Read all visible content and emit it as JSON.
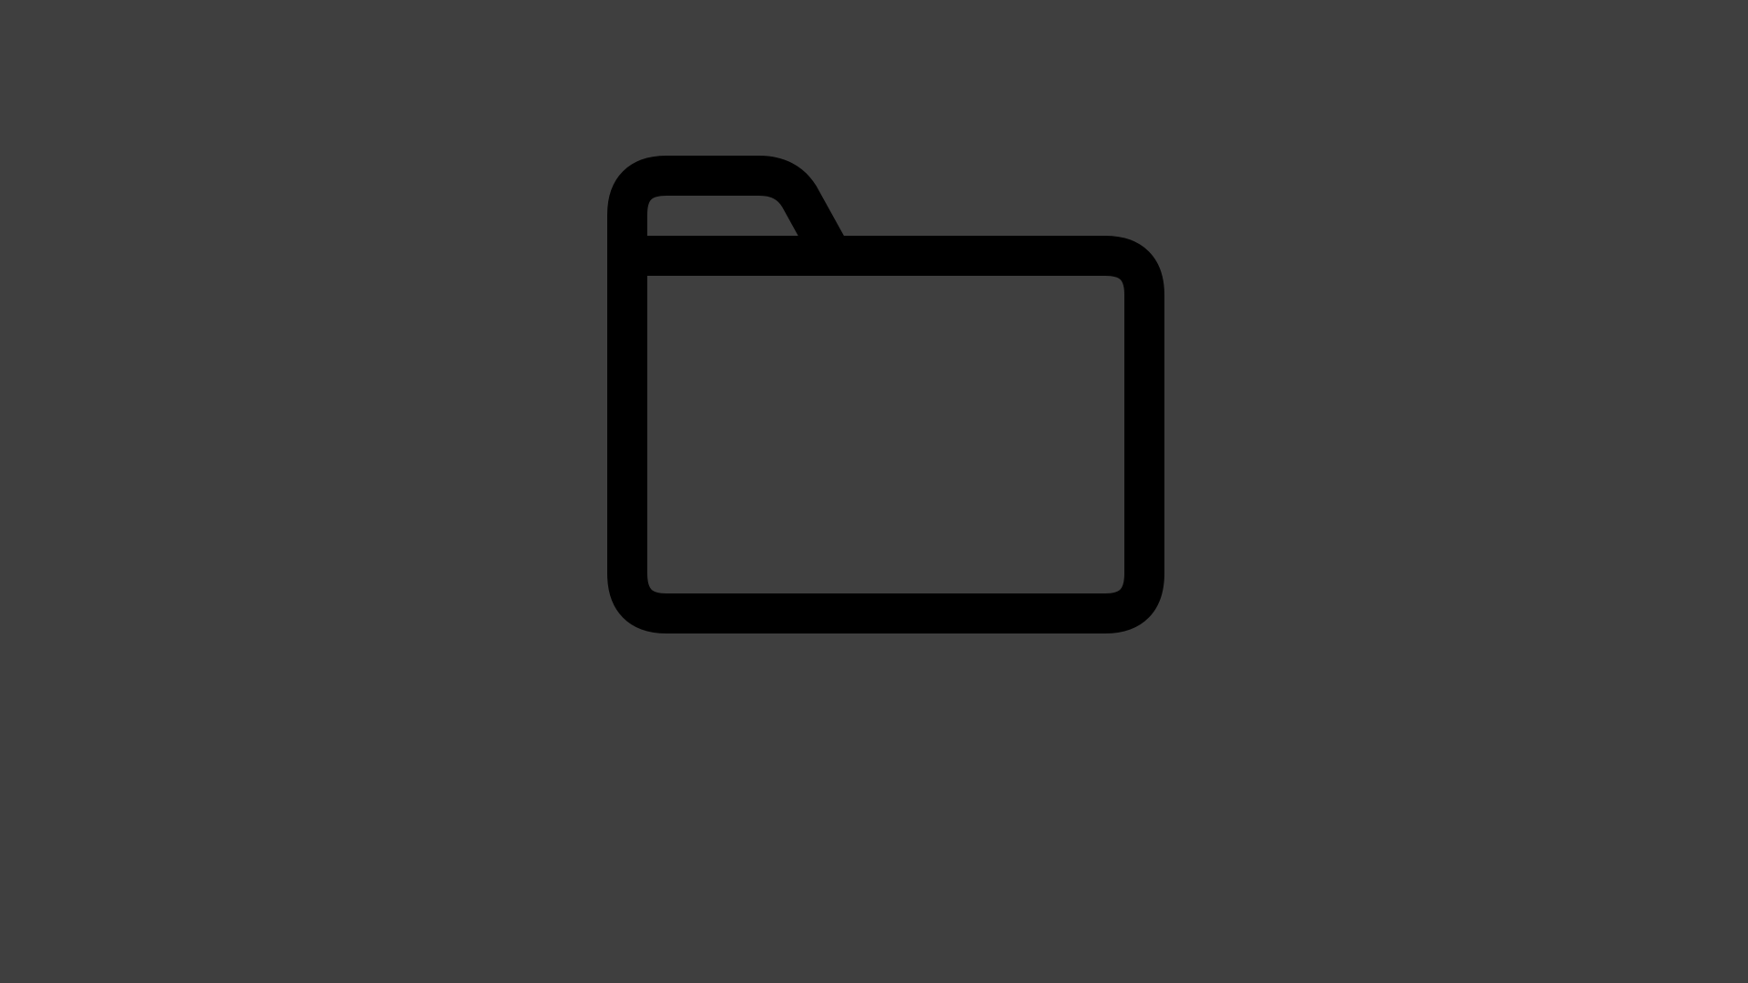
{
  "screen": {
    "background_color": "#3f3f3f"
  },
  "icon": {
    "name": "folder-icon",
    "stroke_color": "#000000"
  }
}
